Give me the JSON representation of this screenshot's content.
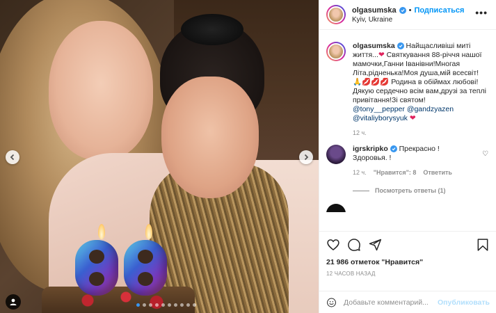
{
  "post": {
    "username": "olgasumska",
    "follow_label": "Подписаться",
    "location": "Kyiv, Ukraine",
    "more_label": "•••"
  },
  "caption": {
    "username": "olgasumska",
    "text_1": "Найщасливіші миті життя...",
    "text_2": " Святкування 88-річчя нашої мамочки,Ганни Іванівни!Многая Літа,рідненька!Моя душа,мій всесвіт!",
    "text_3": "🙏💋💋💋 Родина в обіймах любові! Дякую сердечно всім вам,друзі за теплі привітання!Зі святом!",
    "mention_1": "@tony__pepper",
    "mention_2": "@gandzyazen",
    "mention_3": "@vitaliyborysyuk",
    "heart": "❤",
    "time": "12 ч."
  },
  "comment": {
    "username": "igrskripko",
    "text_1": "Прекрасно !",
    "text_2": "Здоровья. !",
    "time": "12 ч.",
    "likes": "\"Нравится\": 8",
    "reply_label": "Ответить",
    "like_icon": "♡"
  },
  "replies_label": "Посмотреть ответы (1)",
  "partial_comment": "",
  "likes_count": "21 986 отметок \"Нравится\"",
  "posted_time": "12 ЧАСОВ НАЗАД",
  "add_comment": {
    "placeholder": "Добавьте комментарий...",
    "publish_label": "Опубликовать",
    "emoji_icon": "smile-icon"
  },
  "icons": {
    "like": "heart-icon",
    "comment": "comment-icon",
    "share": "share-icon",
    "save": "bookmark-icon"
  },
  "colors": {
    "link": "#0095f6",
    "verified": "#3897f0",
    "muted": "#8e8e8e",
    "heart": "#e0245e"
  },
  "carousel": {
    "count": 10,
    "active_index": 0
  }
}
